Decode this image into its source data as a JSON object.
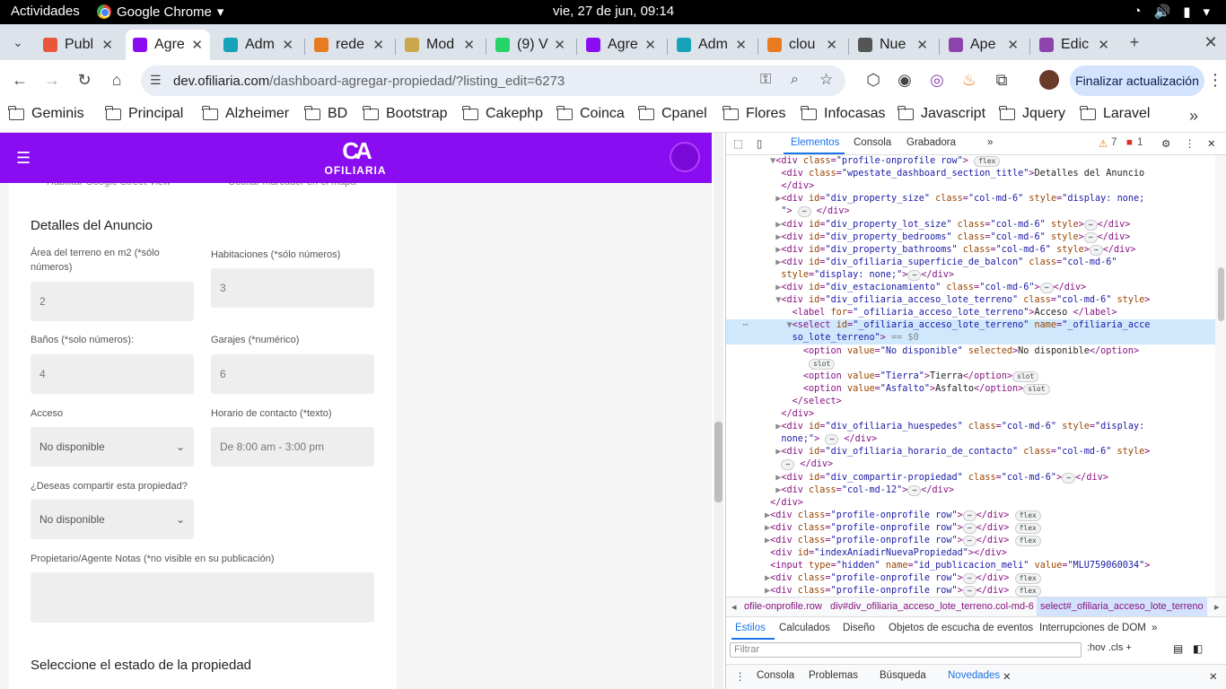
{
  "system_bar": {
    "activities": "Actividades",
    "app_name": "Google Chrome",
    "clock": "vie, 27 de jun, 09:14"
  },
  "tabs": [
    {
      "title": "Publ",
      "favicon_color": "#e8563b"
    },
    {
      "title": "Agre",
      "favicon_color": "#8a0cf0",
      "active": true
    },
    {
      "title": "Adm",
      "favicon_color": "#16a2b8"
    },
    {
      "title": "rede",
      "favicon_color": "#e87b20"
    },
    {
      "title": "Mod",
      "favicon_color": "#c9a84b"
    },
    {
      "title": "(9) V",
      "favicon_color": "#25d366"
    },
    {
      "title": "Agre",
      "favicon_color": "#8a0cf0"
    },
    {
      "title": "Adm",
      "favicon_color": "#16a2b8"
    },
    {
      "title": "clou",
      "favicon_color": "#e87b20"
    },
    {
      "title": "Nue",
      "favicon_color": "#555555"
    },
    {
      "title": "Ape",
      "favicon_color": "#8e44ad"
    },
    {
      "title": "Edic",
      "favicon_color": "#8e44ad"
    }
  ],
  "omnibox": {
    "host": "dev.ofiliaria.com",
    "path": "/dashboard-agregar-propiedad/?listing_edit=6273"
  },
  "update_button": "Finalizar actualización",
  "bookmarks": [
    "Geminis",
    "Principal",
    "Alzheimer",
    "BD",
    "Bootstrap",
    "Cakephp",
    "Coinca",
    "Cpanel",
    "Flores",
    "Infocasas",
    "Javascript",
    "Jquery",
    "Laravel"
  ],
  "site": {
    "brand_mark": "CA",
    "brand": "OFILIARIA",
    "brand_color": "#8a0cf0",
    "partial_top_left": "Habilitar Google Street View",
    "partial_top_right": "Ocultar marcador en el mapa",
    "section_title": "Detalles del Anuncio",
    "fields": {
      "area_label": "Área del terreno en m2 (*sólo números)",
      "area_value": "2",
      "habitaciones_label": "Habitaciones (*sólo números)",
      "habitaciones_value": "3",
      "banos_label": "Baños (*solo números):",
      "banos_value": "4",
      "garajes_label": "Garajes (*numérico)",
      "garajes_value": "6",
      "acceso_label": "Acceso",
      "acceso_value": "No disponible",
      "horario_label": "Horario de contacto (*texto)",
      "horario_placeholder": "De 8:00 am - 3:00 pm",
      "compartir_label": "¿Deseas compartir esta propiedad?",
      "compartir_value": "No disponible",
      "notas_label": "Propietario/Agente Notas (*no visible en su publicación)"
    },
    "estado_title": "Seleccione el estado de la propiedad"
  },
  "devtools": {
    "tabs": [
      "Elementos",
      "Consola",
      "Grabadora",
      "»"
    ],
    "warnings": "7",
    "errors": "1",
    "breadcrumbs": [
      "ofile-onprofile.row",
      "div#div_ofiliaria_acceso_lote_terreno.col-md-6",
      "select#_ofiliaria_acceso_lote_terreno"
    ],
    "style_tabs": [
      "Estilos",
      "Calculados",
      "Diseño",
      "Objetos de escucha de eventos",
      "Interrupciones de DOM",
      "»"
    ],
    "filter_placeholder": "Filtrar",
    "filter_tools": ":hov  .cls  +",
    "drawer_tabs": [
      "Consola",
      "Problemas",
      "Búsqueda",
      "Novedades"
    ]
  }
}
